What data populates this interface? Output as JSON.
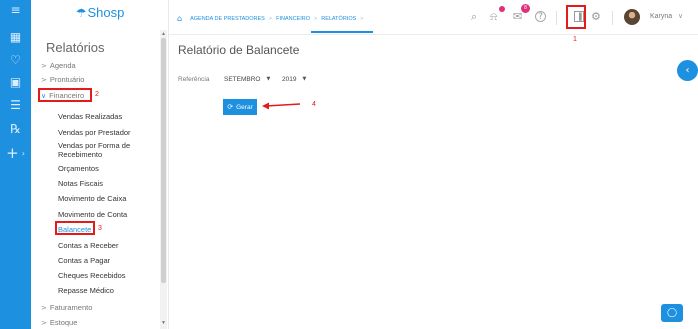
{
  "rail": {
    "icons": [
      "menu-icon",
      "calendar-icon",
      "heart-icon",
      "money-icon",
      "database-icon",
      "receipt-icon",
      "add-icon"
    ],
    "glyphs": [
      "≡",
      "▦",
      "♡",
      "▣",
      "☰",
      "℞",
      "+"
    ],
    "more_glyph": "›"
  },
  "logo": {
    "glyph": "☂",
    "text": "Shosp"
  },
  "sidebar": {
    "title": "Relatórios",
    "items": [
      {
        "label": "Agenda",
        "chev": ">"
      },
      {
        "label": "Prontuário",
        "chev": ">"
      },
      {
        "label": "Financeiro",
        "chev": "∨"
      },
      {
        "label": "Faturamento",
        "chev": ">"
      },
      {
        "label": "Estoque",
        "chev": ">"
      }
    ],
    "sub_items": [
      "Vendas Realizadas",
      "Vendas por Prestador",
      "Vendas por Forma de",
      "Recebimento",
      "Orçamentos",
      "Notas Fiscais",
      "Movimento de Caixa",
      "Movimento de Conta",
      "Balancete",
      "Contas a Receber",
      "Contas a Pagar",
      "Cheques Recebidos",
      "Repasse Médico"
    ],
    "scroll_up": "▲",
    "scroll_down": "▼"
  },
  "breadcrumb": {
    "home_glyph": "⌂",
    "items": [
      "AGENDA DE PRESTADORES",
      "FINANCEIRO",
      "RELATÓRIOS"
    ],
    "sep": ">"
  },
  "topbar": {
    "search_glyph": "⌕",
    "bell_glyph": "⍾",
    "chat_glyph": "✉",
    "help_glyph": "?",
    "report_glyph": "▐",
    "gear_glyph": "⚙",
    "chat_badge": "8",
    "username": "Karyna",
    "user_chev": "∨"
  },
  "annotations": [
    "1",
    "2",
    "3",
    "4"
  ],
  "main": {
    "title": "Relatório de Balancete",
    "ref_label": "Referência",
    "month": "SETEMBRO",
    "year": "2019",
    "caret": "▼",
    "gerar_icon": "⟳",
    "gerar_label": "Gerar"
  },
  "floating": {
    "collapse_glyph": "‹",
    "chat_glyph": "◯"
  },
  "colors": {
    "accent": "#1e90e0",
    "annotation": "#e31b1b",
    "badge_orange": "#f08a24",
    "badge_pink": "#e0307a"
  }
}
